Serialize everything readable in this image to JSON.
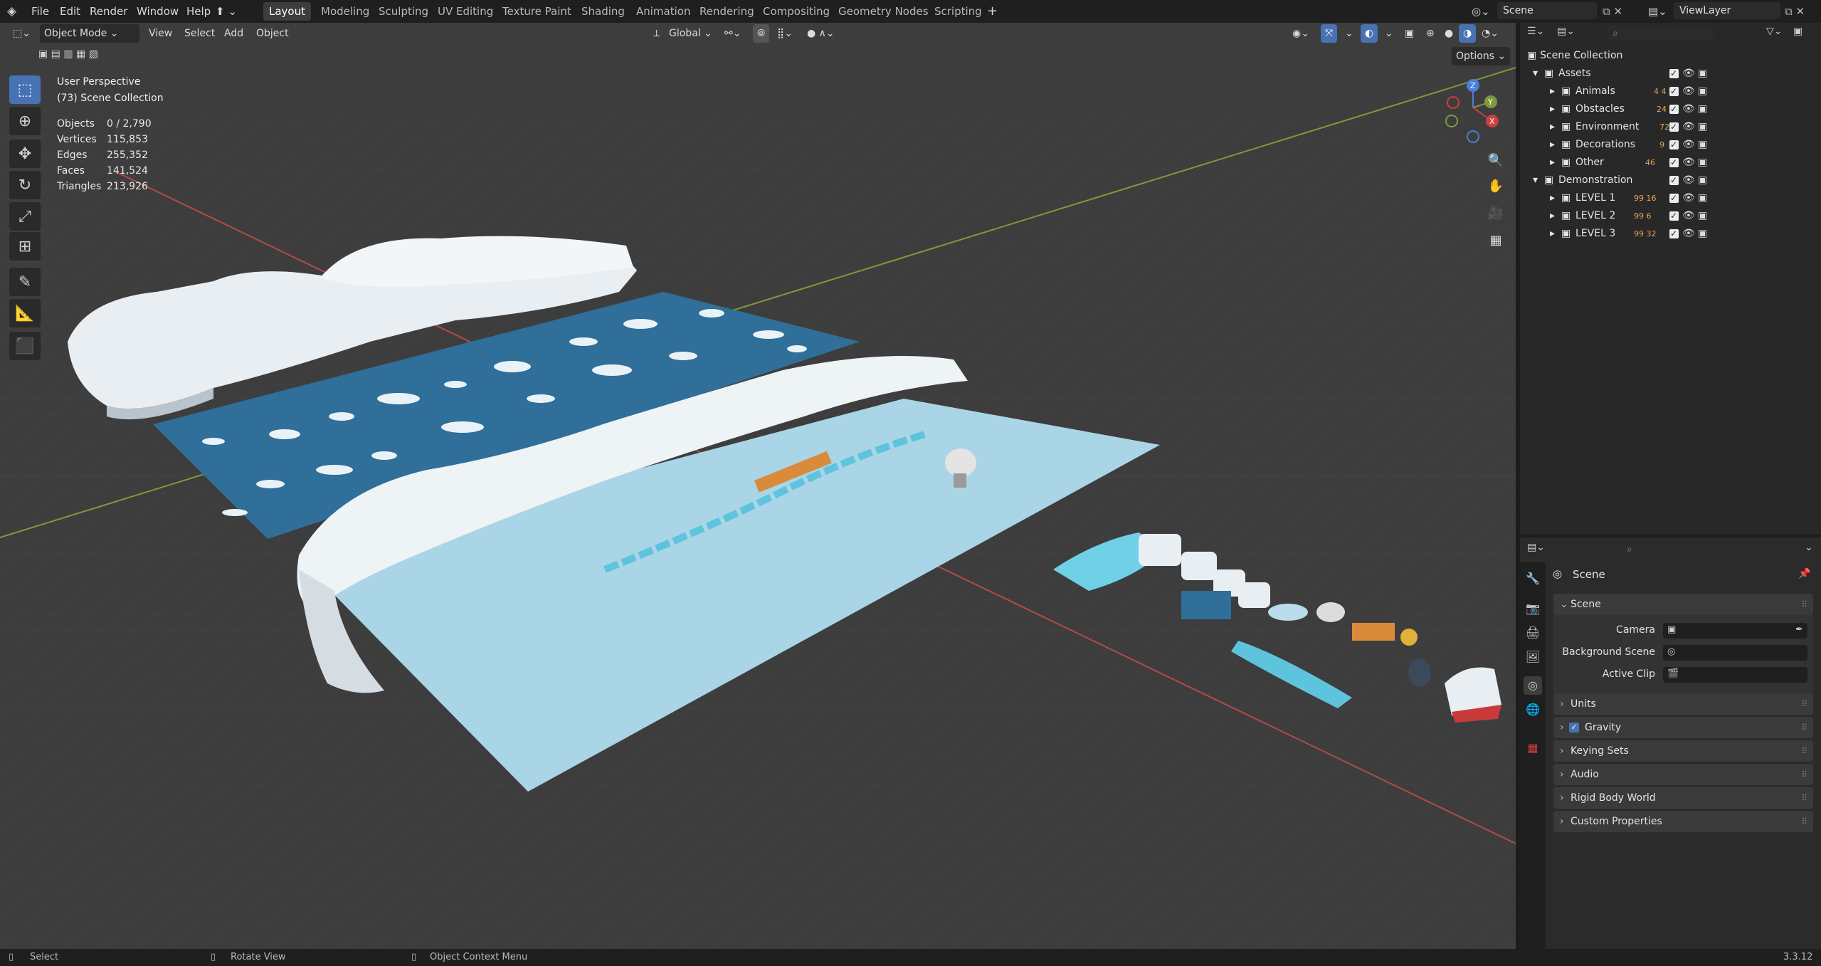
{
  "menu": {
    "file": "File",
    "edit": "Edit",
    "render": "Render",
    "window": "Window",
    "help": "Help"
  },
  "workspaces": [
    "Layout",
    "Modeling",
    "Sculpting",
    "UV Editing",
    "Texture Paint",
    "Shading",
    "Animation",
    "Rendering",
    "Compositing",
    "Geometry Nodes",
    "Scripting"
  ],
  "scene_field": "Scene",
  "view_layer_field": "ViewLayer",
  "viewport_header": {
    "mode": "Object Mode",
    "view": "View",
    "select": "Select",
    "add": "Add",
    "object": "Object",
    "orientation": "Global",
    "options": "Options"
  },
  "overlay_text": {
    "perspective": "User Perspective",
    "collection": "(73) Scene Collection"
  },
  "stats": [
    {
      "label": "Objects",
      "value": "0 / 2,790"
    },
    {
      "label": "Vertices",
      "value": "115,853"
    },
    {
      "label": "Edges",
      "value": "255,352"
    },
    {
      "label": "Faces",
      "value": "141,524"
    },
    {
      "label": "Triangles",
      "value": "213,926"
    }
  ],
  "gizmo": {
    "x": "X",
    "y": "Y",
    "z": "Z"
  },
  "outliner": {
    "root": "Scene Collection",
    "rows": [
      {
        "name": "Assets",
        "badge": ""
      },
      {
        "name": "Animals",
        "badge": "4  4"
      },
      {
        "name": "Obstacles",
        "badge": "24"
      },
      {
        "name": "Environment",
        "badge": "72"
      },
      {
        "name": "Decorations",
        "badge": "9"
      },
      {
        "name": "Other",
        "badge": "46"
      },
      {
        "name": "Demonstration",
        "badge": ""
      },
      {
        "name": "LEVEL 1",
        "badge": "99  16"
      },
      {
        "name": "LEVEL 2",
        "badge": "99  6"
      },
      {
        "name": "LEVEL 3",
        "badge": "99  32"
      }
    ]
  },
  "properties": {
    "context": "Scene",
    "scene_panel": "Scene",
    "camera_label": "Camera",
    "background_scene_label": "Background Scene",
    "active_clip_label": "Active Clip",
    "panels": [
      "Units",
      "Gravity",
      "Keying Sets",
      "Audio",
      "Rigid Body World",
      "Custom Properties"
    ]
  },
  "statusbar": {
    "select": "Select",
    "rotate": "Rotate View",
    "context_menu": "Object Context Menu",
    "version": "3.3.12"
  },
  "colors": {
    "accent": "#4772b3",
    "viewport_bg": "#3d3d3d",
    "grid_x_axis": "#b34a4a",
    "grid_y_axis": "#7d9a3c",
    "water": "#2f6f99",
    "ice_floor": "#a9d5e6",
    "snow": "#e9eef2"
  }
}
